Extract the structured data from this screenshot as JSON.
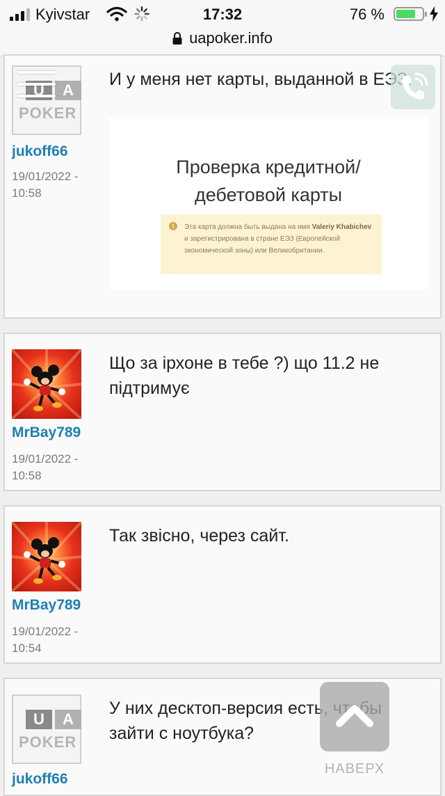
{
  "status_bar": {
    "carrier": "Kyivstar",
    "time": "17:32",
    "battery_percent": "76 %",
    "battery_level": 0.76,
    "signal_bars_active": 3,
    "signal_bars_total": 4
  },
  "url_bar": {
    "domain": "uapoker.info"
  },
  "posts": [
    {
      "avatar": "ua-poker-logo",
      "avatar_text": {
        "u": "U",
        "a": "A",
        "poker": "POKER"
      },
      "username": "jukoff66",
      "date_line1": "19/01/2022 -",
      "date_line2": "10:58",
      "text": "И у меня нет карты, выданной в ЕЭЗ.",
      "embed": {
        "title_line1": "Проверка кредитной/",
        "title_line2": "дебетовой карты",
        "warning_pre": "Эта карта должна быть выдана на имя ",
        "warning_name": "Valeriy Khabichev",
        "warning_post": " и зарегистрирована в стране ЕЭЗ (Европейской экономической зоны) или Великобритании.",
        "warning_icon": "!"
      }
    },
    {
      "avatar": "mickey-mouse-image",
      "username": "MrBay789",
      "date_line1": "19/01/2022 -",
      "date_line2": "10:58",
      "text": "Що за ірхоне в тебе ?) що 11.2 не підтримує"
    },
    {
      "avatar": "mickey-mouse-image",
      "username": "MrBay789",
      "date_line1": "19/01/2022 -",
      "date_line2": "10:54",
      "text": "Так звісно, через сайт."
    },
    {
      "avatar": "ua-poker-logo",
      "avatar_text": {
        "u": "U",
        "a": "A",
        "poker": "POKER"
      },
      "username": "jukoff66",
      "text": "У них десктоп-версия есть, чтобы зайти с ноутбука?"
    }
  ],
  "controls": {
    "menu_icon": "hamburger-icon",
    "phone_icon": "phone-icon",
    "scroll_top_label": "НАВЕРХ"
  },
  "colors": {
    "username": "#1f7fb3",
    "battery_fill": "#4cd964",
    "warning_bg": "#fdf3d3"
  }
}
